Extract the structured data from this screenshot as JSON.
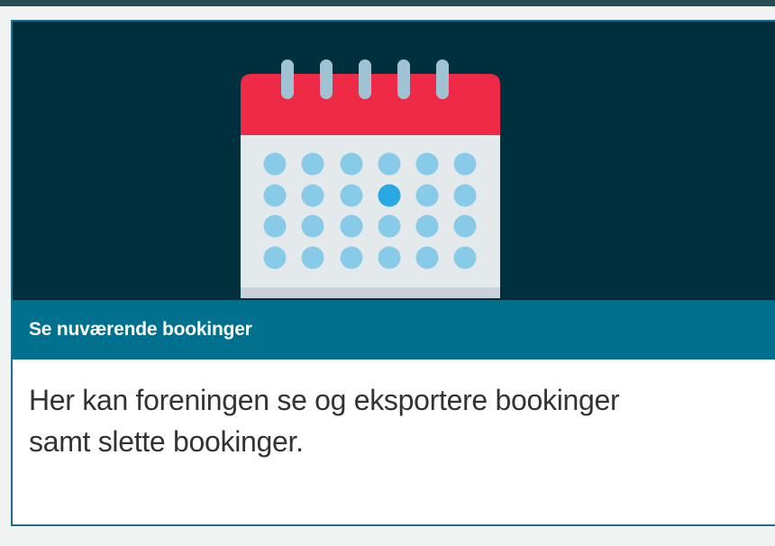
{
  "card": {
    "title": "Se nuværende bookinger",
    "description": "Her kan foreningen se og eksportere bookinger samt slette bookinger.",
    "icon": "calendar-icon",
    "highlighted_day": {
      "row": 2,
      "column": 4
    }
  },
  "colors": {
    "page_background": "#f1f2f2",
    "top_strip": "#264d54",
    "image_background": "#002f3d",
    "title_bar": "#00708f",
    "card_border": "#1e6f89",
    "calendar_header": "#ee2a47",
    "calendar_body": "#e4e9ec",
    "calendar_rings": "#9fc3d2",
    "calendar_dot": "#88cbe8",
    "calendar_dot_highlight": "#28a9e1"
  }
}
